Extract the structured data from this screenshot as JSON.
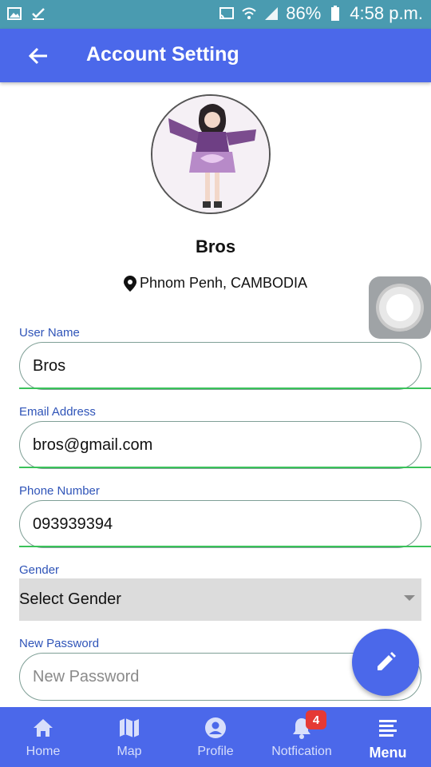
{
  "status_bar": {
    "battery": "86%",
    "time": "4:58 p.m.",
    "icons": [
      "gallery-icon",
      "check-icon",
      "cast-icon",
      "wifi-icon",
      "signal-icon",
      "battery-icon"
    ]
  },
  "app_bar": {
    "title": "Account Setting",
    "back_icon": "arrow-left-icon"
  },
  "profile": {
    "name": "Bros",
    "location": "Phnom Penh, CAMBODIA",
    "location_icon": "map-pin-icon"
  },
  "form": {
    "username": {
      "label": "User Name",
      "value": "Bros"
    },
    "email": {
      "label": "Email Address",
      "value": "bros@gmail.com"
    },
    "phone": {
      "label": "Phone Number",
      "value": "093939394"
    },
    "gender": {
      "label": "Gender",
      "selected": "Select Gender"
    },
    "password": {
      "label": "New Password",
      "placeholder": "New Password"
    }
  },
  "fab": {
    "icon": "pencil-icon"
  },
  "bottom_nav": {
    "items": [
      {
        "label": "Home",
        "icon": "home-icon"
      },
      {
        "label": "Map",
        "icon": "map-icon"
      },
      {
        "label": "Profile",
        "icon": "profile-icon"
      },
      {
        "label": "Notfication",
        "icon": "bell-icon",
        "badge": "4"
      },
      {
        "label": "Menu",
        "icon": "menu-icon",
        "active": true
      }
    ]
  },
  "colors": {
    "primary": "#4b68ea",
    "status_bar": "#4a9bb0",
    "label": "#2f54b8",
    "underline": "#3ac25a",
    "badge": "#e53935"
  }
}
